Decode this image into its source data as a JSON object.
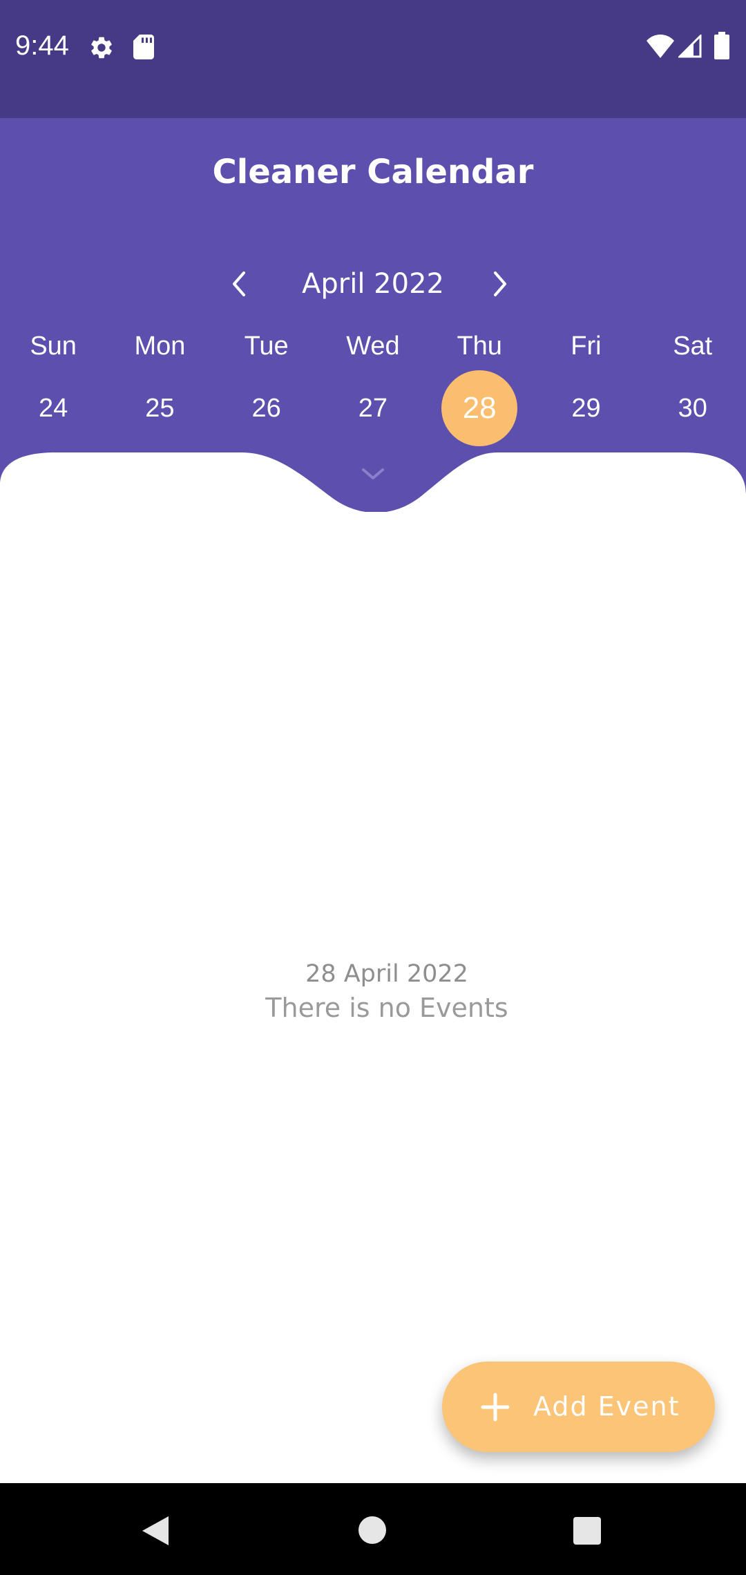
{
  "status_bar": {
    "time": "9:44",
    "icons": [
      "gear-icon",
      "sd-card-icon",
      "wifi-icon",
      "cell-signal-icon",
      "battery-icon"
    ]
  },
  "header": {
    "title": "Cleaner Calendar",
    "month_label": "April 2022",
    "prev_icon": "chevron-left-icon",
    "next_icon": "chevron-right-icon",
    "weekdays": [
      "Sun",
      "Mon",
      "Tue",
      "Wed",
      "Thu",
      "Fri",
      "Sat"
    ],
    "days": [
      "24",
      "25",
      "26",
      "27",
      "28",
      "29",
      "30"
    ],
    "selected_day": "28",
    "collapse_icon": "chevron-down-icon"
  },
  "empty_state": {
    "date": "28 April 2022",
    "message": "There is no Events"
  },
  "fab": {
    "label": "Add Event",
    "icon": "plus-icon"
  },
  "navigation_bar": {
    "icons": [
      "back-icon",
      "home-icon",
      "recents-icon"
    ]
  },
  "colors": {
    "status_bar": "#463a86",
    "header": "#5c4fae",
    "accent": "#fbbe6e",
    "fab": "#fbc477",
    "muted_text": "#9a9a9a"
  }
}
